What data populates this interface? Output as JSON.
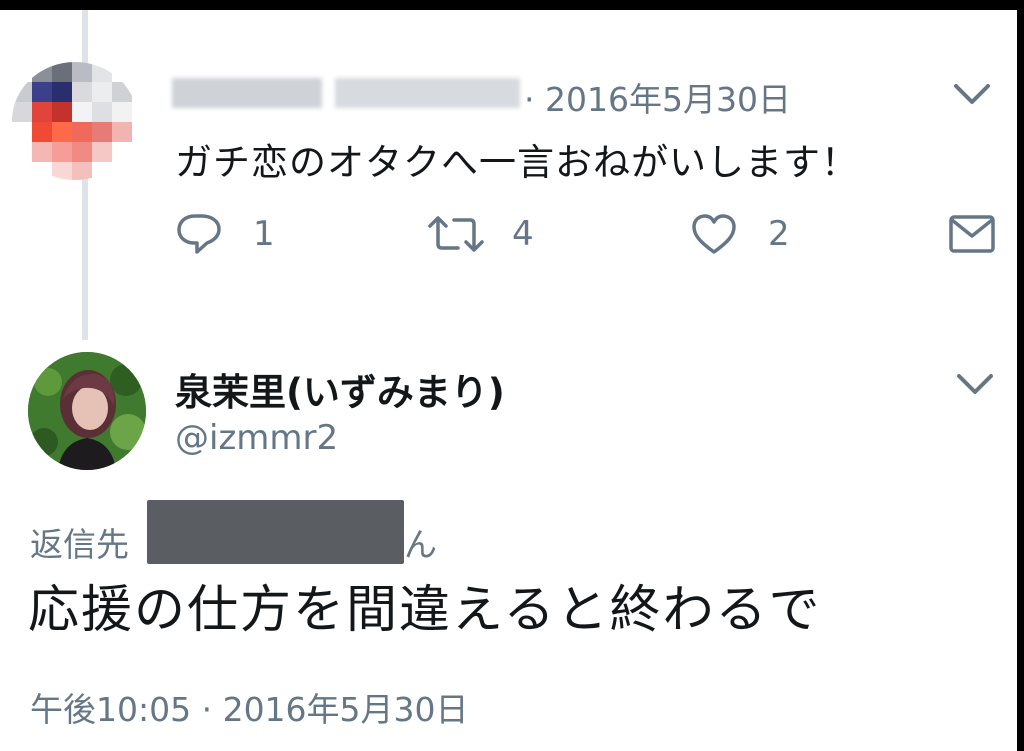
{
  "colors": {
    "text": "#14171a",
    "secondary": "#657786",
    "thread_line": "#dde3e8",
    "redaction": "#5a5d61"
  },
  "tweet1": {
    "meta": "· 2016年5月30日",
    "text": "ガチ恋のオタクへ一言おねがいします！",
    "actions": {
      "reply_count": "1",
      "retweet_count": "4",
      "like_count": "2"
    },
    "icons": [
      "reply-icon",
      "retweet-icon",
      "like-icon",
      "dm-icon",
      "chevron-down-icon"
    ]
  },
  "tweet2": {
    "name": "泉茉里(いずみまり)",
    "handle": "@izmmr2",
    "reply_to_label": "返信先",
    "reply_to_suffix": "ん",
    "text": "応援の仕方を間違えると終わるで",
    "timestamp": "午後10:05 · 2016年5月30日"
  }
}
